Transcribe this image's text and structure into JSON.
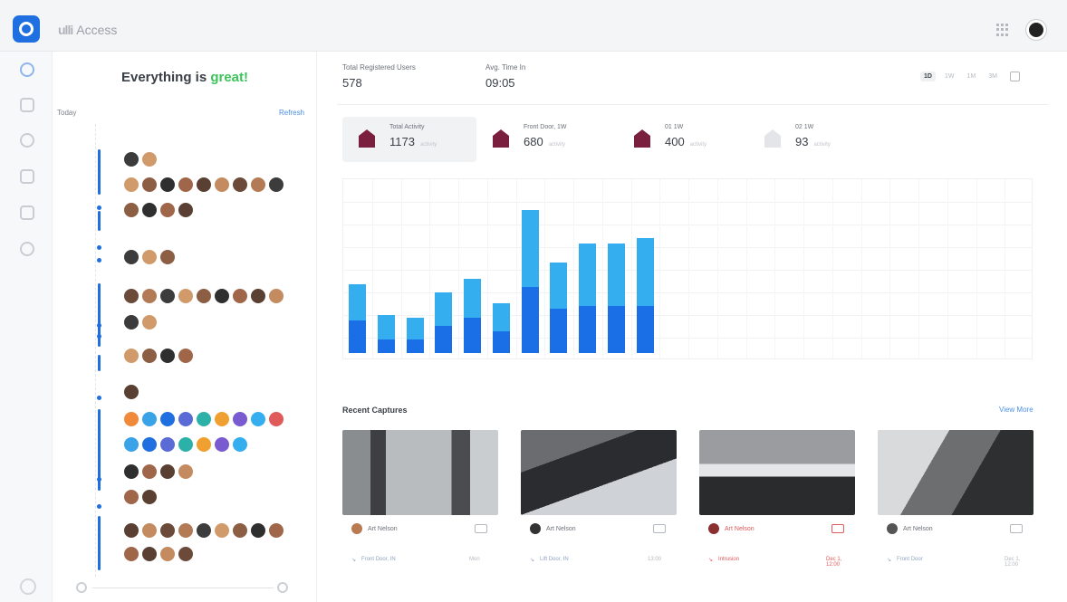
{
  "app": {
    "name": "Access",
    "brand_mark": "ulli"
  },
  "feed": {
    "title_prefix": "Everything is ",
    "title_highlight": "great!",
    "today_label": "Today",
    "refresh_label": "Refresh"
  },
  "stats": {
    "registered_label": "Total Registered Users",
    "registered_value": "578",
    "avg_label": "Avg. Time In",
    "avg_value": "09:05"
  },
  "ranges": [
    "1D",
    "1W",
    "1M",
    "3M"
  ],
  "cards": [
    {
      "label": "Total Activity",
      "value": "1173",
      "sub": "activity"
    },
    {
      "label": "Front Door, 1W",
      "value": "680",
      "sub": "activity"
    },
    {
      "label": "01 1W",
      "value": "400",
      "sub": "activity"
    },
    {
      "label": "02 1W",
      "value": "93",
      "sub": "activity"
    }
  ],
  "colors": {
    "accent": "#1f6fe0",
    "bar_light": "#35aef0",
    "bar_dark": "#1a6ee6",
    "great": "#3cc35a"
  },
  "chart_data": {
    "type": "bar",
    "stacked": true,
    "categories_count": 24,
    "series": [
      {
        "values": [
          13,
          9,
          8,
          12,
          14,
          10,
          28,
          17,
          23,
          23,
          25,
          0,
          0,
          0,
          0,
          0,
          0,
          0,
          0,
          0,
          0,
          0,
          0,
          0
        ]
      },
      {
        "values": [
          12,
          5,
          5,
          10,
          13,
          8,
          24,
          16,
          17,
          17,
          17,
          0,
          0,
          0,
          0,
          0,
          0,
          0,
          0,
          0,
          0,
          0,
          0,
          0
        ]
      }
    ],
    "grid": true
  },
  "recent": {
    "title": "Recent Captures",
    "more": "View More",
    "items": [
      {
        "name": "Art Nelson",
        "loc": "Front Door, IN",
        "time": "Mon",
        "alert": false
      },
      {
        "name": "Art Nelson",
        "loc": "Lift Door, IN",
        "time": "13:00",
        "alert": false
      },
      {
        "name": "Art Nelson",
        "loc": "Intrusion",
        "time": "Dec 1, 12:00",
        "alert": true
      },
      {
        "name": "Art Nelson",
        "loc": "Front Door",
        "time": "Dec 1, 12:00",
        "alert": false
      }
    ]
  }
}
